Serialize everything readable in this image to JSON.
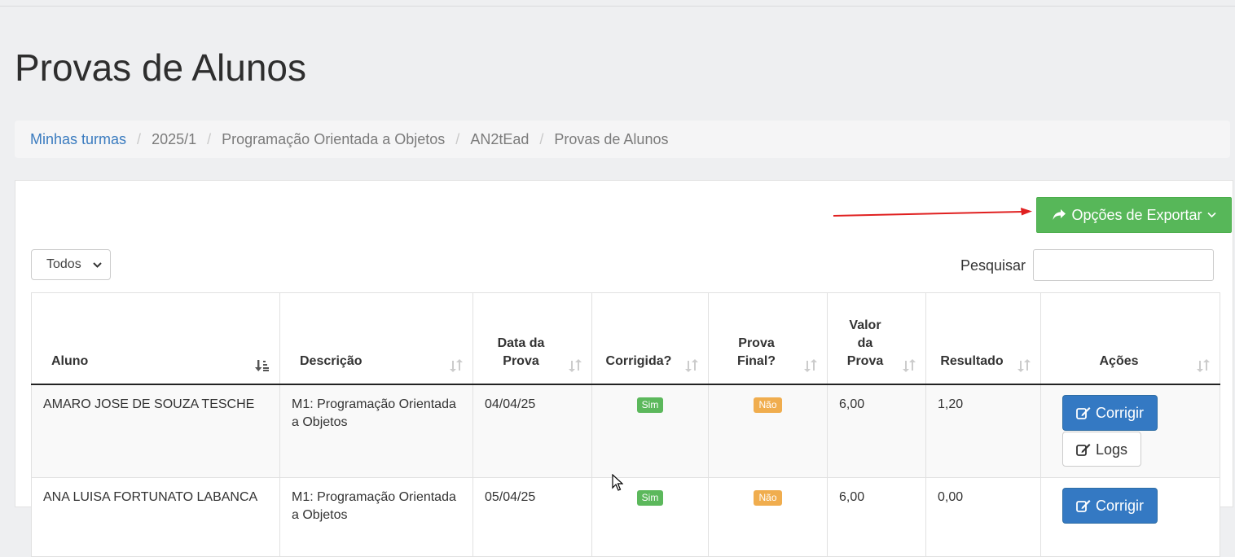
{
  "page": {
    "title": "Provas de Alunos"
  },
  "breadcrumb": [
    "Minhas turmas",
    "2025/1",
    "Programação Orientada a Objetos",
    "AN2tEad",
    "Provas de Alunos"
  ],
  "toolbar": {
    "export_label": "Opções de Exportar"
  },
  "filters": {
    "length_value": "Todos",
    "search_label": "Pesquisar",
    "search_value": ""
  },
  "table": {
    "headers": {
      "aluno": "Aluno",
      "descricao": "Descrição",
      "data1": "Data da",
      "data2": "Prova",
      "corrigida": "Corrigida?",
      "final1": "Prova",
      "final2": "Final?",
      "valor1": "Valor",
      "valor2": "da",
      "valor3": "Prova",
      "resultado": "Resultado",
      "acoes": "Ações"
    },
    "rows": [
      {
        "aluno": "AMARO JOSE DE SOUZA TESCHE",
        "descricao1": "M1: Programação Orientada",
        "descricao2": "a Objetos",
        "data": "04/04/25",
        "corrigida": "Sim",
        "final": "Não",
        "valor": "6,00",
        "resultado": "1,20",
        "corrigir": "Corrigir",
        "logs": "Logs"
      },
      {
        "aluno": "ANA LUISA FORTUNATO LABANCA",
        "descricao1": "M1: Programação Orientada",
        "descricao2": "a Objetos",
        "data": "05/04/25",
        "corrigida": "Sim",
        "final": "Não",
        "valor": "6,00",
        "resultado": "0,00",
        "corrigir": "Corrigir"
      }
    ]
  },
  "colors": {
    "export_button": "#57b759",
    "primary_button": "#3479c3",
    "link": "#3a7bbf",
    "badge_green": "#5cb85c",
    "badge_orange": "#f0ad4e",
    "annotation_arrow": "#e02020"
  }
}
